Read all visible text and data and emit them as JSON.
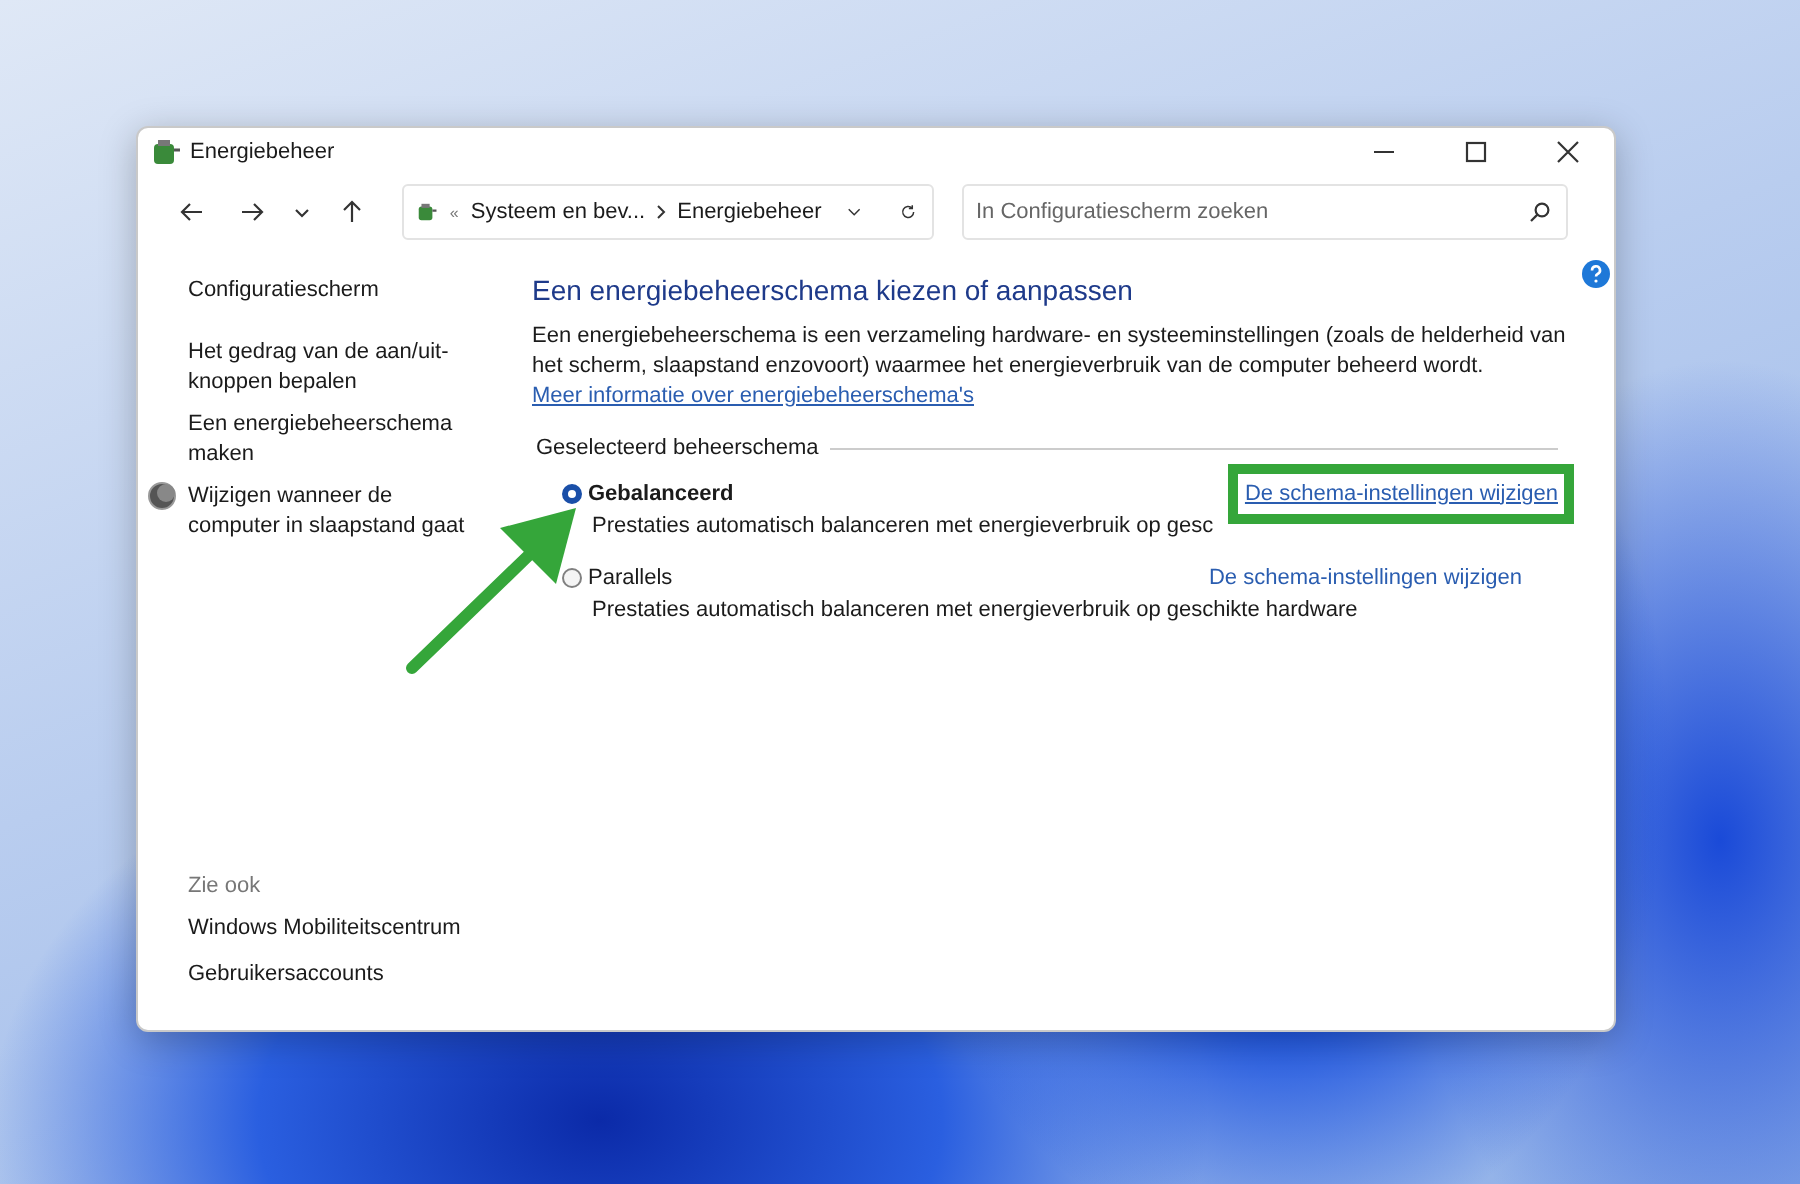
{
  "window": {
    "title": "Energiebeheer"
  },
  "address_bar": {
    "overflow": "«",
    "breadcrumb": [
      "Systeem en bev...",
      "Energiebeheer"
    ]
  },
  "search": {
    "placeholder": "In Configuratiescherm zoeken"
  },
  "sidebar": {
    "items": [
      {
        "label": "Configuratiescherm",
        "kind": "home"
      },
      {
        "label": "Het gedrag van de aan/uit-knoppen bepalen",
        "kind": "link"
      },
      {
        "label": "Een energiebeheerschema maken",
        "kind": "link"
      },
      {
        "label": "Wijzigen wanneer de computer in slaapstand gaat",
        "kind": "moon"
      }
    ],
    "see_also": {
      "title": "Zie ook",
      "items": [
        "Windows Mobiliteitscentrum",
        "Gebruikersaccounts"
      ]
    }
  },
  "content": {
    "heading": "Een energiebeheerschema kiezen of aanpassen",
    "intro": "Een energiebeheerschema is een verzameling hardware- en systeeminstellingen (zoals de helderheid van het scherm, slaapstand enzovoort) waarmee het energieverbruik van de computer beheerd wordt.",
    "intro_link": "Meer informatie over energiebeheerschema's",
    "section": "Geselecteerd beheerschema",
    "plans": [
      {
        "name": "Gebalanceerd",
        "description": "Prestaties automatisch balanceren met energieverbruik op gesc",
        "link": "De schema-instellingen wijzigen",
        "selected": true,
        "highlighted": true
      },
      {
        "name": "Parallels",
        "description": "Prestaties automatisch balanceren met energieverbruik op geschikte hardware",
        "link": "De schema-instellingen wijzigen",
        "selected": false,
        "highlighted": false
      }
    ]
  }
}
